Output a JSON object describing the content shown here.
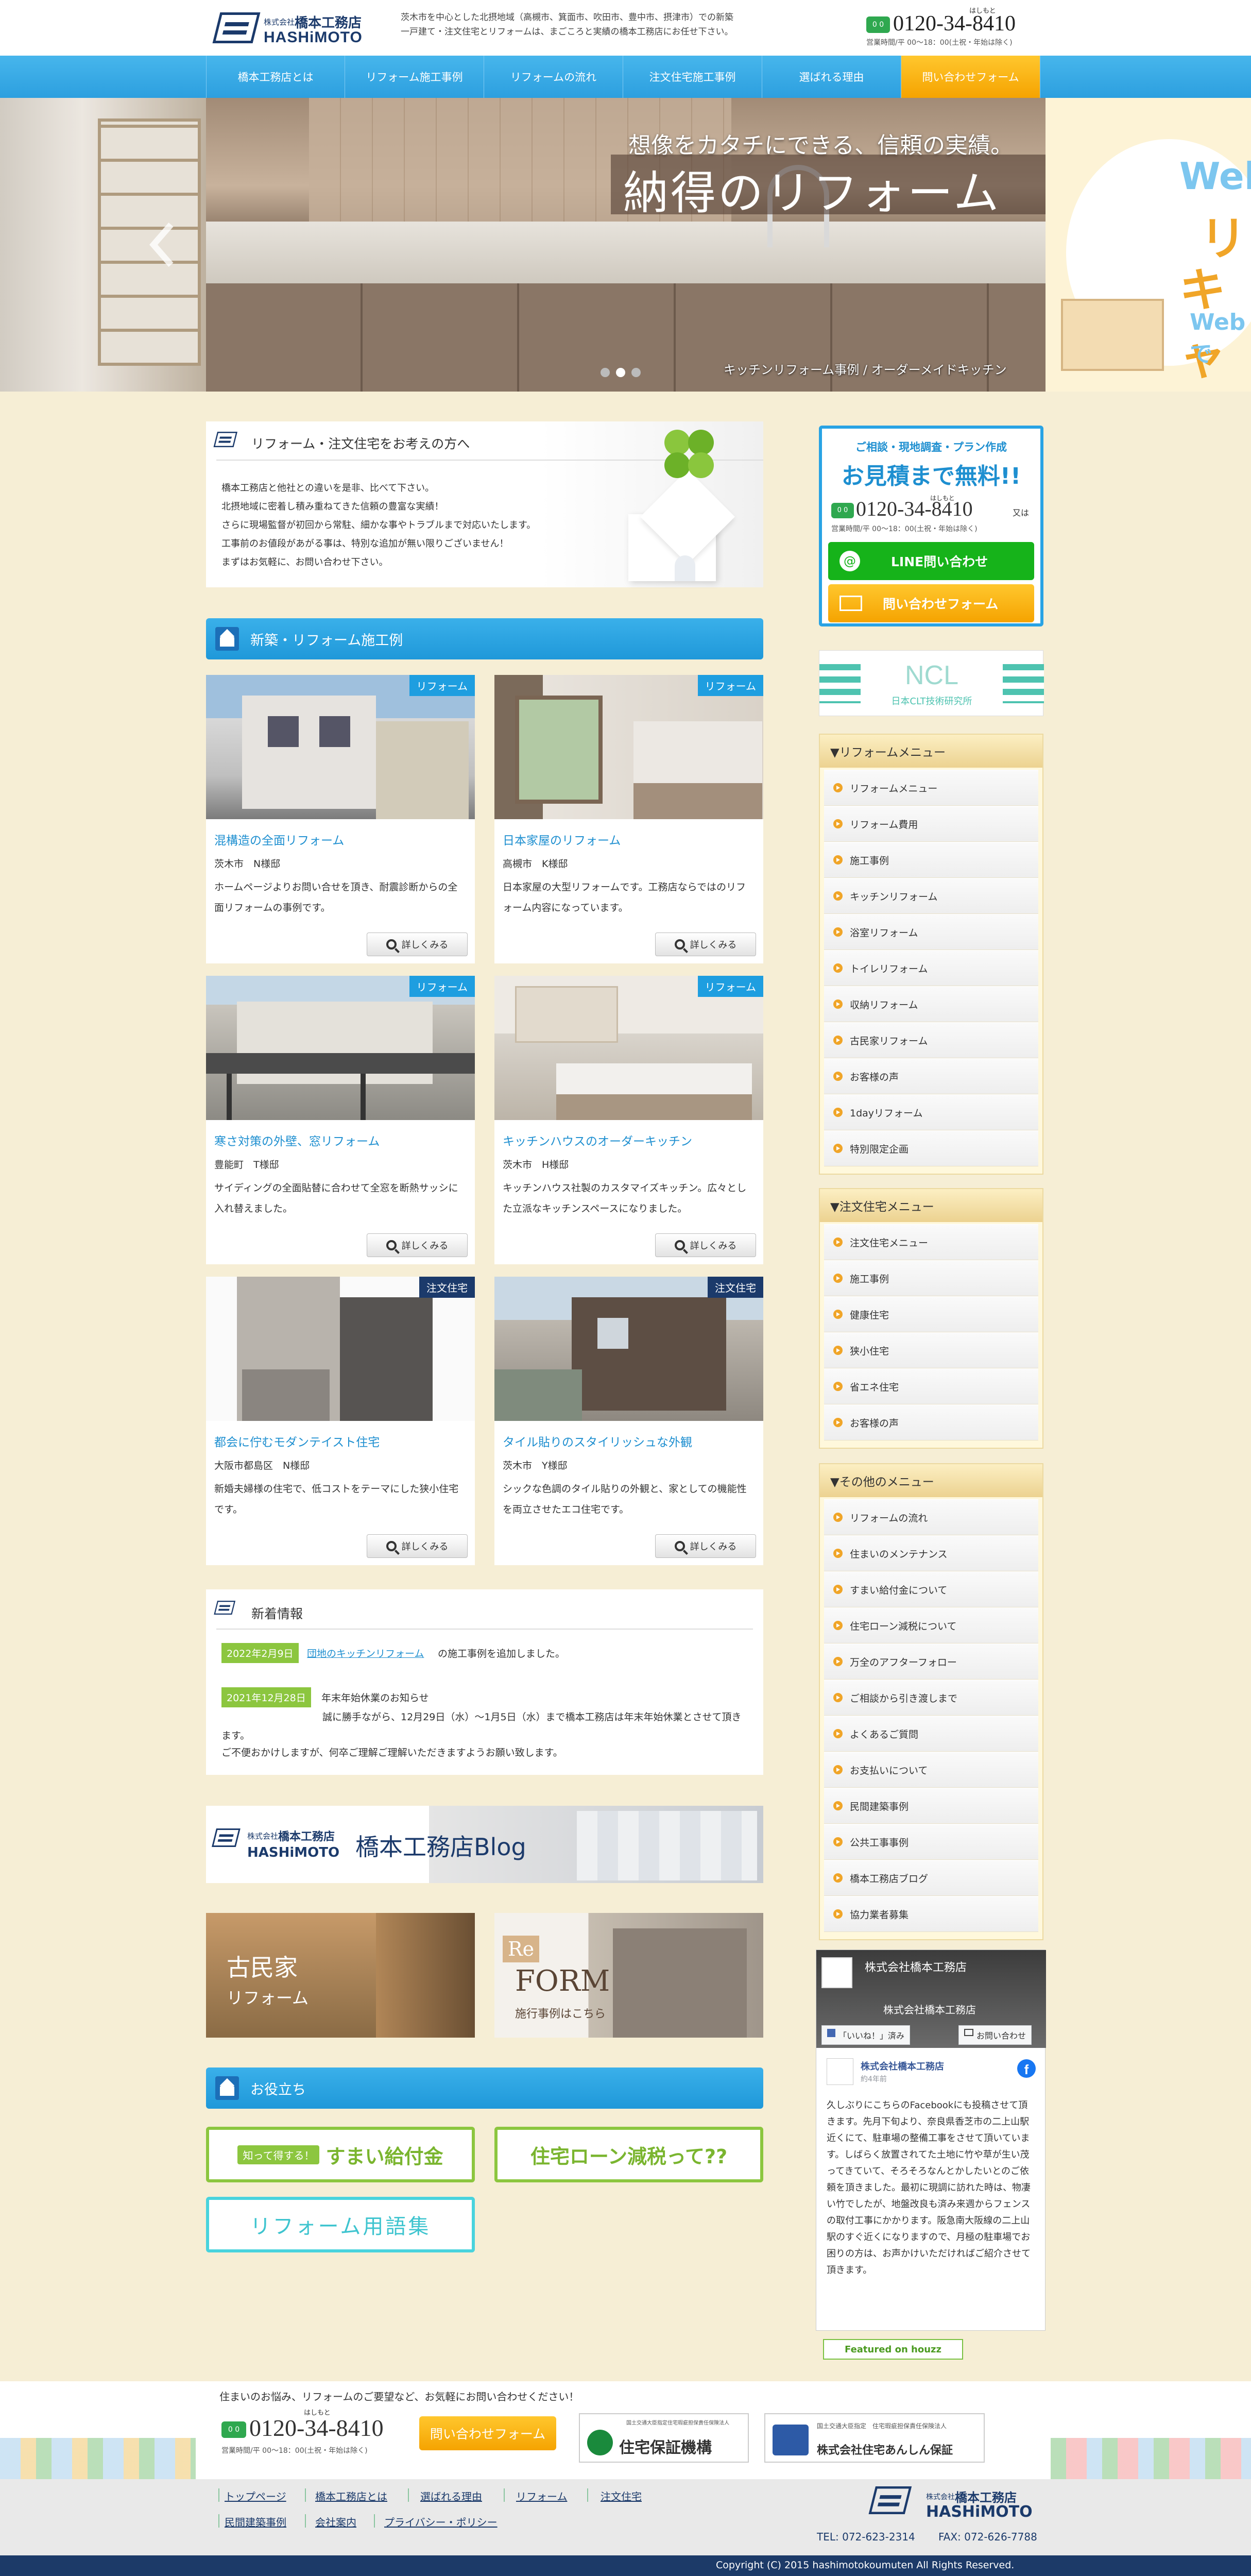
{
  "header": {
    "company_small": "株式会社",
    "company_name": "橋本工務店",
    "company_roman": "HASHiMOTO",
    "intro_line1": "茨木市を中心とした北摂地域（高槻市、箕面市、吹田市、豊中市、摂津市）での新築",
    "intro_line2": "一戸建て・注文住宅とリフォームは、まごころと実績の橋本工務店にお任せ下さい。",
    "phone_ruby": "はしもと",
    "phone": "0120-34-8410",
    "hours": "営業時間/平 00〜18：00(土祝・年始は除く)"
  },
  "nav": [
    "橋本工務店とは",
    "リフォーム施工事例",
    "リフォームの流れ",
    "注文住宅施工事例",
    "選ばれる理由",
    "問い合わせフォーム"
  ],
  "hero": {
    "catch_sub": "想像をカタチにできる、信頼の実績。",
    "catch_main": "納得のリフォーム",
    "caption": "キッチンリフォーム事例 / オーダーメイドキッチン",
    "right_banner": [
      "Web",
      "リ",
      "キャ",
      "Webで"
    ]
  },
  "intro": {
    "title": "リフォーム・注文住宅をお考えの方へ",
    "lines": [
      "橋本工務店と他社との違いを是非、比べて下さい。",
      "北摂地域に密着し積み重ねてきた信頼の豊富な実績！",
      "さらに現場監督が初回から常駐、細かな事やトラブルまで対応いたします。",
      "工事前のお値段があがる事は、特別な追加が無い限りございません！",
      "まずはお気軽に、お問い合わせ下さい。"
    ]
  },
  "works_title": "新築・リフォーム施工例",
  "more_label": "詳しくみる",
  "works": [
    {
      "tag": "リフォーム",
      "title": "混構造の全面リフォーム",
      "who": "茨木市　N様邸",
      "desc": "ホームページよりお問い合せを頂き、耐震診断からの全面リフォームの事例です。"
    },
    {
      "tag": "リフォーム",
      "title": "日本家屋のリフォーム",
      "who": "高槻市　K様邸",
      "desc": "日本家屋の大型リフォームです。工務店ならではのリフォーム内容になっています。"
    },
    {
      "tag": "リフォーム",
      "title": "寒さ対策の外壁、窓リフォーム",
      "who": "豊能町　T様邸",
      "desc": "サイディングの全面貼替に合わせて全窓を断熱サッシに入れ替えました。"
    },
    {
      "tag": "リフォーム",
      "title": "キッチンハウスのオーダーキッチン",
      "who": "茨木市　H様邸",
      "desc": "キッチンハウス社製のカスタマイズキッチン。広々とした立派なキッチンスペースになりました。"
    },
    {
      "tag": "注文住宅",
      "title": "都会に佇むモダンテイスト住宅",
      "who": "大阪市都島区　N様邸",
      "desc": "新婚夫婦様の住宅で、低コストをテーマにした狭小住宅です。"
    },
    {
      "tag": "注文住宅",
      "title": "タイル貼りのスタイリッシュな外観",
      "who": "茨木市　Y様邸",
      "desc": "シックな色調のタイル貼りの外観と、家としての機能性を両立させたエコ住宅です。"
    }
  ],
  "news": {
    "title": "新着情報",
    "items": [
      {
        "date": "2022年2月9日",
        "link": "団地のキッチンリフォーム",
        "text": "の施工事例を追加しました。"
      },
      {
        "date": "2021年12月28日",
        "text": "年末年始休業のお知らせ",
        "body1": "誠に勝手ながら、12月29日（水）〜1月5日（水）まで橋本工務店は年末年始休業とさせて頂きます。",
        "body2": "ご不便おかけしますが、何卒ご理解ご理解いただきますようお願い致します。"
      }
    ]
  },
  "blog": {
    "small": "株式会社",
    "company": "橋本工務店",
    "roman": "HASHiMOTO",
    "label": "橋本工務店Blog"
  },
  "banners": {
    "kominka_1": "古民家",
    "kominka_2": "リフォーム",
    "reform_1": "Re",
    "reform_2": "FORM",
    "reform_3": "施行事例はこちら"
  },
  "useful": {
    "title": "お役立ち",
    "btn1_small": "知って得する！",
    "btn1": "すまい給付金",
    "btn2": "住宅ローン減税って??",
    "btn3": "リフォーム用語集"
  },
  "sidebar": {
    "cta_line1": "ご相談・現地調査・プラン作成",
    "cta_line2": "お見積まで無料!!",
    "phone_ruby": "はしもと",
    "phone": "0120-34-8410",
    "phone_suffix": "又は",
    "hours": "営業時間/平 00〜18：00(土祝・年始は除く)",
    "line_btn": "LINE問い合わせ",
    "form_btn": "問い合わせフォーム",
    "ncl": "NCL",
    "ncl_sub": "日本CLT技術研究所",
    "menus": [
      {
        "title": "▼リフォームメニュー",
        "items": [
          "リフォームメニュー",
          "リフォーム費用",
          "施工事例",
          "キッチンリフォーム",
          "浴室リフォーム",
          "トイレリフォーム",
          "収納リフォーム",
          "古民家リフォーム",
          "お客様の声",
          "1dayリフォーム",
          "特別限定企画"
        ]
      },
      {
        "title": "▼注文住宅メニュー",
        "items": [
          "注文住宅メニュー",
          "施工事例",
          "健康住宅",
          "狭小住宅",
          "省エネ住宅",
          "お客様の声"
        ]
      },
      {
        "title": "▼その他のメニュー",
        "items": [
          "リフォームの流れ",
          "住まいのメンテナンス",
          "すまい給付金について",
          "住宅ローン減税について",
          "万全のアフターフォロー",
          "ご相談から引き渡しまで",
          "よくあるご質問",
          "お支払いについて",
          "民間建築事例",
          "公共工事事例",
          "橋本工務店ブログ",
          "協力業者募集"
        ]
      }
    ],
    "fb": {
      "page": "株式会社橋本工務店",
      "cover_caption": "株式会社橋本工務店",
      "like": "「いいね！」済み",
      "msg": "お問い合わせ",
      "post_name": "株式会社橋本工務店",
      "post_time": "約4年前",
      "post": "久しぶりにこちらのFacebookにも投稿させて頂きます。先月下旬より、奈良県香芝市の二上山駅近くにて、駐車場の整備工事をさせて頂いています。しばらく放置されてた土地に竹や草が生い茂ってきていて、そろそろなんとかしたいとのご依頼を頂きました。最初に現調に訪れた時は、物凄い竹でしたが、地盤改良も済み来週からフェンスの取付工事にかかります。阪急南大阪線の二上山駅のすぐ近くになりますので、月極の駐車場でお困りの方は、お声かけいただければご紹介させて頂きます。"
    },
    "houzz": "Featured on houzz"
  },
  "footer": {
    "msg": "住まいのお悩み、リフォームのご要望など、お気軽にお問い合わせください！",
    "phone_ruby": "はしもと",
    "phone": "0120-34-8410",
    "hours": "営業時間/平 00〜18：00(土祝・年始は除く)",
    "form_btn": "問い合わせフォーム",
    "badge1_small": "国土交通大臣指定住宅瑕疵担保責任保険法人",
    "badge1": "住宅保証機構",
    "badge2_small": "国土交通大臣指定　住宅瑕疵担保責任保険法人",
    "badge2": "株式会社住宅あんしん保証",
    "links": [
      "トップページ",
      "橋本工務店とは",
      "選ばれる理由",
      "リフォーム",
      "注文住宅",
      "民間建築事例",
      "会社案内",
      "プライバシー・ポリシー"
    ],
    "small": "株式会社",
    "company": "橋本工務店",
    "roman": "HASHiMOTO",
    "tel": "TEL: 072-623-2314",
    "fax": "FAX: 072-626-7788",
    "copyright": "Copyright (C) 2015 hashimotokoumuten All Rights Reserved."
  }
}
